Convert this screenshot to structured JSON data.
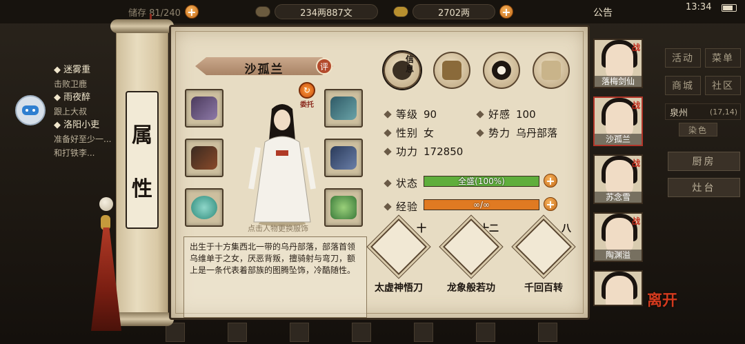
{
  "topbar": {
    "notice": "公告",
    "time": "13:34",
    "storage": "储存 81/240",
    "silver": "234两887文",
    "gold": "2702两"
  },
  "quests": [
    {
      "title": "◆ 迷雾重",
      "sub": "击败卫鹿"
    },
    {
      "title": "◆ 雨夜醉",
      "sub": "跟上大叔"
    },
    {
      "title": "◆ 洛阳小吏",
      "sub": "准备好至少一..."
    },
    {
      "title": "",
      "sub": "和打铁李..."
    }
  ],
  "right_menu": {
    "activity": "活动",
    "menu": "菜单",
    "shop": "商城",
    "community": "社区",
    "location_name": "泉州",
    "location_coords": "(17,14)",
    "kitchen": "厨房",
    "stove": "灶台",
    "color_label": "染色"
  },
  "attr_tab": [
    "属",
    "性"
  ],
  "character": {
    "name": "沙孤兰",
    "review": "评",
    "delegate": "委托",
    "hint": "点击人物更换服饰",
    "description": "出生于十方集西北一带的乌丹部落，部落首领乌维单于之女，厌恶背叛，擅骑射与弯刀，额上是一条代表着部族的图腾坠饰，冷酷随性。"
  },
  "tabs": [
    {
      "name": "info",
      "label": "信息"
    },
    {
      "name": "bag",
      "label": ""
    },
    {
      "name": "taiji",
      "label": ""
    },
    {
      "name": "meridian",
      "label": ""
    }
  ],
  "stats": {
    "level_label": "等级",
    "level_value": "90",
    "favor_label": "好感",
    "favor_value": "100",
    "gender_label": "性别",
    "gender_value": "女",
    "faction_label": "势力",
    "faction_value": "乌丹部落",
    "power_label": "功力",
    "power_value": "172850",
    "state_label": "状态",
    "state_value": "全盛(100%)",
    "state_fraction": 1.0,
    "exp_label": "经验",
    "exp_value": "∞/∞",
    "exp_fraction": 1.0
  },
  "skills": [
    {
      "name": "太虚神悟刀",
      "level": "十"
    },
    {
      "name": "龙象般若功",
      "level": "十二"
    },
    {
      "name": "千回百转",
      "level": "八"
    }
  ],
  "roster": [
    {
      "name": "落梅剑仙",
      "war": "战"
    },
    {
      "name": "沙孤兰",
      "war": "战"
    },
    {
      "name": "苏念雪",
      "war": "战"
    },
    {
      "name": "陶渊溢",
      "war": "战"
    },
    {
      "name": "",
      "war": ""
    }
  ],
  "leave_label": "离开",
  "colors": {
    "state_bar": "#5fae3c",
    "exp_bar": "#e07a22",
    "accent_red": "#b3362a"
  }
}
